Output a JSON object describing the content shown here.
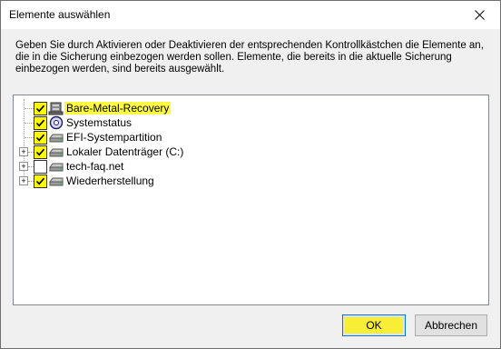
{
  "window": {
    "title": "Elemente auswählen"
  },
  "description": "Geben Sie durch Aktivieren oder Deaktivieren der entsprechenden Kontrollkästchen die Elemente an, die in die Sicherung einbezogen werden sollen. Elemente, die bereits in die aktuelle Sicherung einbezogen werden, sind bereits ausgewählt.",
  "tree": {
    "items": [
      {
        "label": "Bare-Metal-Recovery",
        "checked": true,
        "expandable": false,
        "icon": "server-icon",
        "highlighted": true
      },
      {
        "label": "Systemstatus",
        "checked": true,
        "expandable": false,
        "icon": "system-state-icon",
        "highlighted": false
      },
      {
        "label": "EFI-Systempartition",
        "checked": true,
        "expandable": false,
        "icon": "drive-icon",
        "highlighted": false
      },
      {
        "label": "Lokaler Datenträger (C:)",
        "checked": true,
        "expandable": true,
        "icon": "drive-icon",
        "highlighted": false
      },
      {
        "label": "tech-faq.net",
        "checked": false,
        "expandable": true,
        "icon": "drive-icon",
        "highlighted": false
      },
      {
        "label": "Wiederherstellung",
        "checked": true,
        "expandable": true,
        "icon": "drive-icon",
        "highlighted": false
      }
    ]
  },
  "buttons": {
    "ok": "OK",
    "cancel": "Abbrechen"
  },
  "colors": {
    "highlight": "#fffb40",
    "ok_highlight": "#f6ef36",
    "focus_border": "#0078d7"
  }
}
